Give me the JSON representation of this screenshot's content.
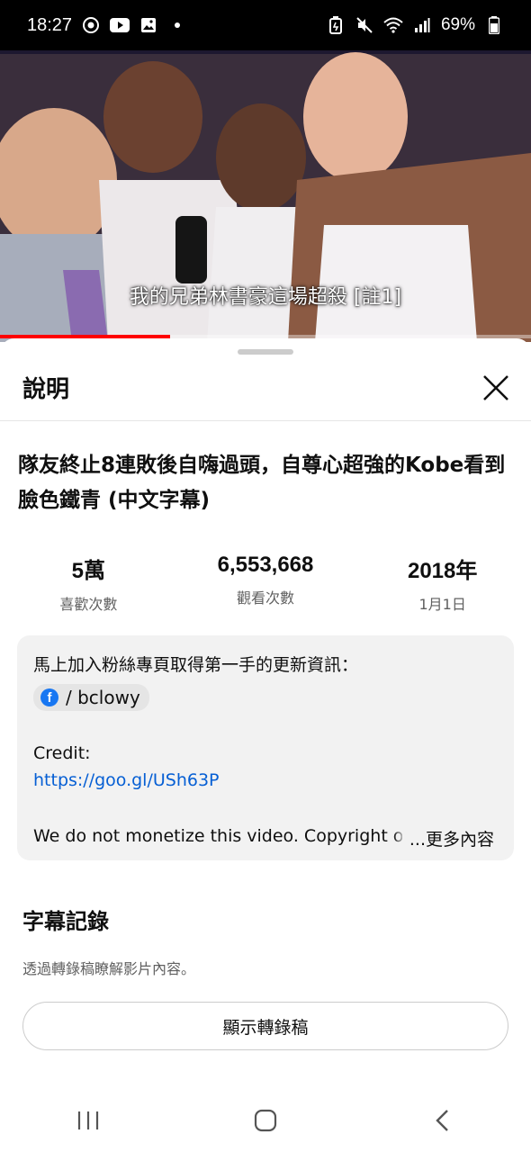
{
  "status_bar": {
    "time": "18:27",
    "battery": "69%",
    "icons": [
      "chrome-icon",
      "youtube-icon",
      "gallery-icon",
      "dot-icon",
      "battery-saver-icon",
      "mute-icon",
      "wifi-icon",
      "signal-icon",
      "battery-icon"
    ]
  },
  "video": {
    "subtitle": "我的兄弟林書豪這場超殺 [註1]",
    "progress_fraction": 0.32
  },
  "sheet": {
    "title": "說明",
    "video_title": "隊友終止8連敗後自嗨過頭，自尊心超強的Kobe看到臉色鐵青 (中文字幕)",
    "stats": [
      {
        "value": "5萬",
        "label": "喜歡次數"
      },
      {
        "value": "6,553,668",
        "label": "觀看次數"
      },
      {
        "value": "2018年",
        "label": "1月1日"
      }
    ],
    "description": {
      "line1": "馬上加入粉絲專頁取得第一手的更新資訊：",
      "fb_handle": "/ bclowy",
      "credit_label": "Credit:",
      "link": "https://goo.gl/USh63P",
      "last_line": "We do not monetize this video. Copyright o",
      "more": "...更多內容"
    },
    "transcript": {
      "title": "字幕記錄",
      "desc": "透過轉錄稿瞭解影片內容。",
      "button": "顯示轉錄稿"
    }
  },
  "colors": {
    "accent_red": "#ff0000",
    "link_blue": "#065fd4",
    "facebook_blue": "#1877f2"
  }
}
